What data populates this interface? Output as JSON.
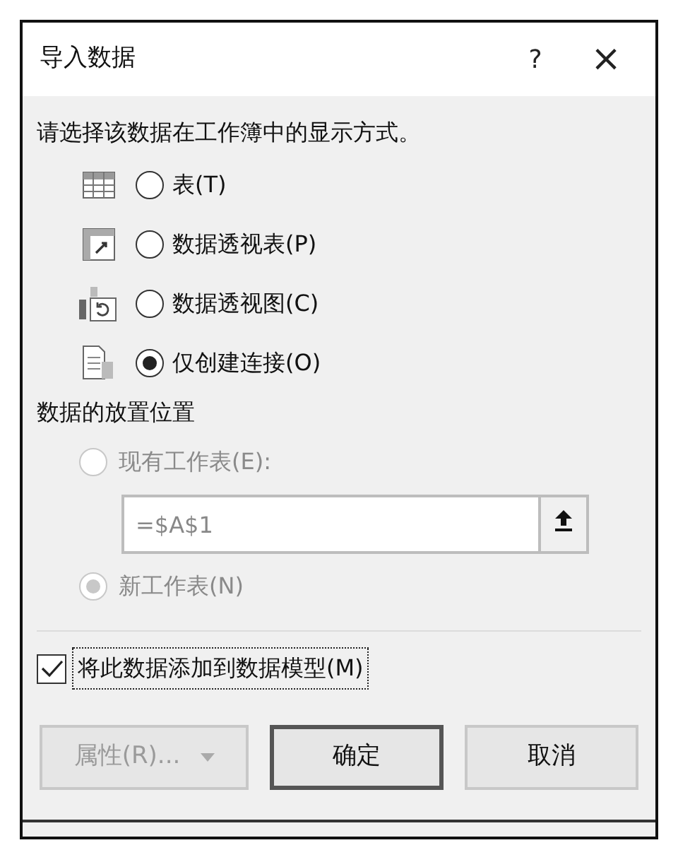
{
  "window": {
    "title": "导入数据",
    "help": "?",
    "close": "×"
  },
  "display": {
    "prompt": "请选择该数据在工作簿中的显示方式。",
    "options": [
      {
        "kind": "table",
        "label": "表(T)",
        "selected": false
      },
      {
        "kind": "pivot_table",
        "label": "数据透视表(P)",
        "selected": false
      },
      {
        "kind": "pivot_chart",
        "label": "数据透视图(C)",
        "selected": false
      },
      {
        "kind": "connection",
        "label": "仅创建连接(O)",
        "selected": true
      }
    ]
  },
  "location": {
    "heading": "数据的放置位置",
    "disabled": true,
    "existing": {
      "label": "现有工作表(E):",
      "selected": false
    },
    "range": {
      "value": "=$A$1"
    },
    "new": {
      "label": "新工作表(N)",
      "selected": true
    }
  },
  "data_model": {
    "label": "将此数据添加到数据模型(M)",
    "checked": true
  },
  "buttons": [
    {
      "kind": "dropdown",
      "label": "属性(R)...",
      "disabled": true,
      "default": false
    },
    {
      "kind": "plain",
      "label": "确定",
      "disabled": false,
      "default": true
    },
    {
      "kind": "plain",
      "label": "取消",
      "disabled": false,
      "default": false
    }
  ]
}
